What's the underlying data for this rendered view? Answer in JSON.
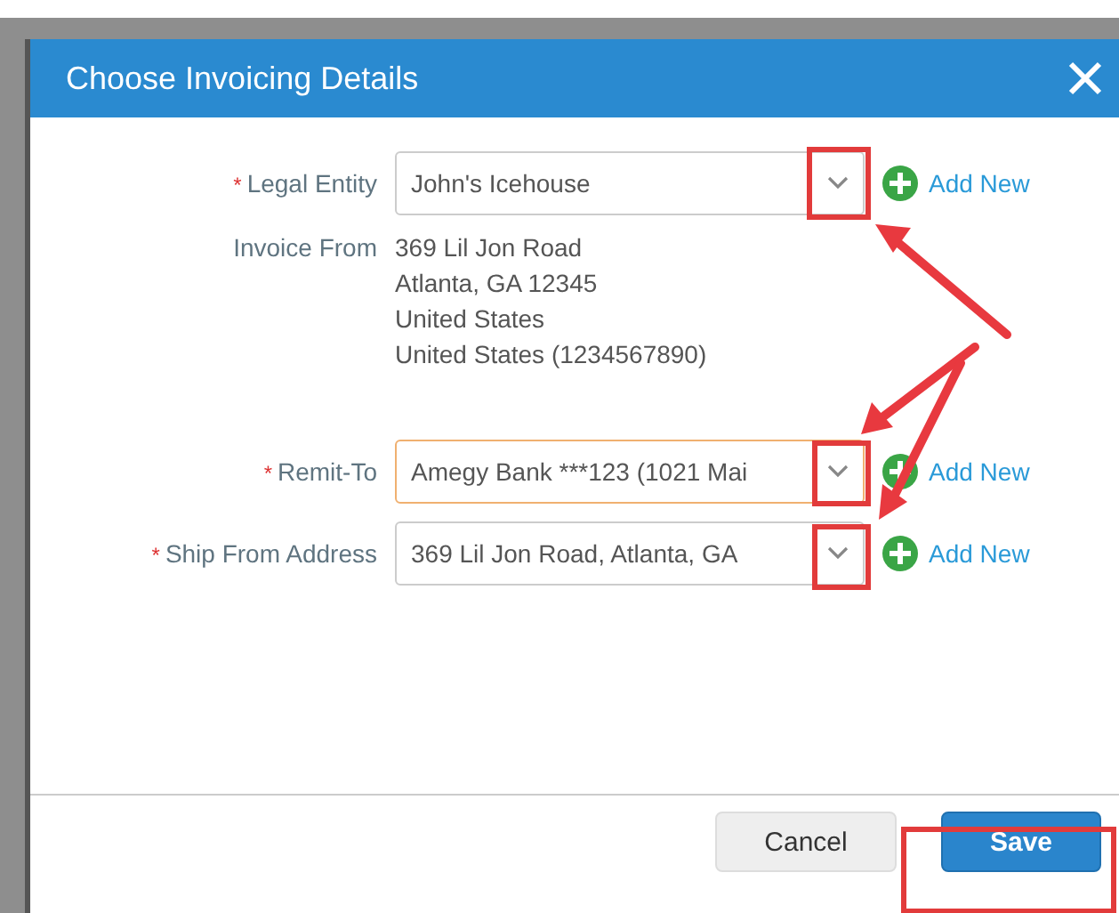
{
  "dialog": {
    "title": "Choose Invoicing Details"
  },
  "fields": [
    {
      "kind": "select",
      "mark": "*",
      "label": "Legal Entity",
      "value": "John's Icehouse",
      "focused": false,
      "add_label": "Add New"
    },
    {
      "kind": "address",
      "label": "Invoice From",
      "lines": [
        "369 Lil Jon Road",
        "Atlanta, GA 12345",
        "United States",
        "United States (1234567890)"
      ]
    },
    {
      "kind": "select",
      "mark": "*",
      "label": "Remit-To",
      "value": "Amegy Bank ***123 (1021 Mai",
      "focused": true,
      "add_label": "Add New"
    },
    {
      "kind": "select",
      "mark": "*",
      "label": "Ship From Address",
      "value": "369 Lil Jon Road, Atlanta, GA",
      "focused": false,
      "add_label": "Add New"
    }
  ],
  "buttons": [
    {
      "label": "Cancel",
      "kind": "secondary"
    },
    {
      "label": "Save",
      "kind": "primary"
    }
  ]
}
